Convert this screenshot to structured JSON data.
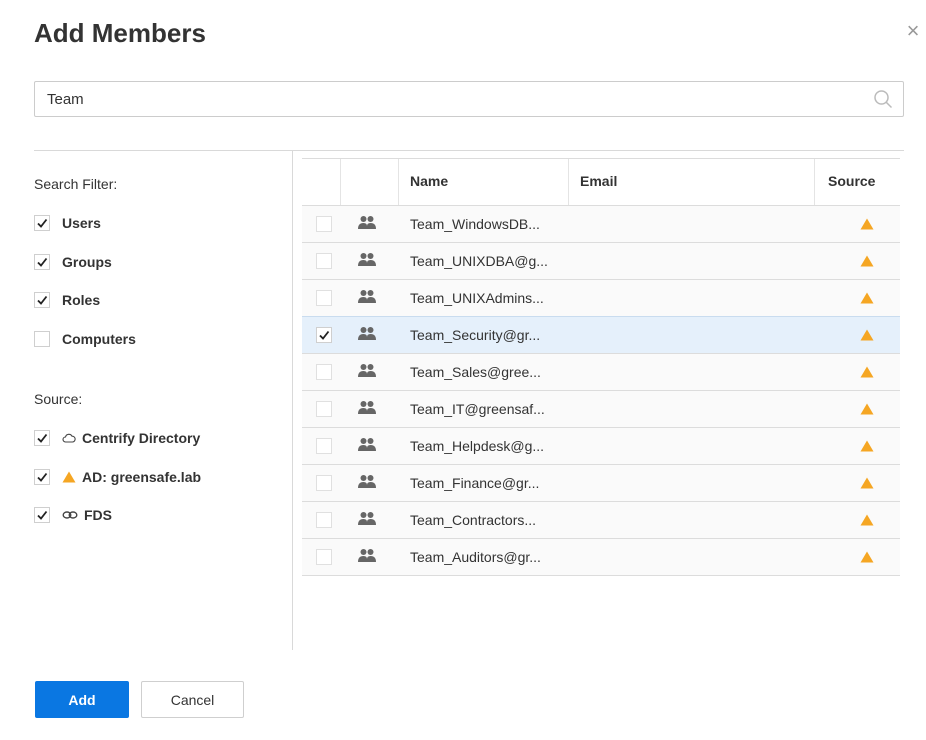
{
  "dialog": {
    "title": "Add Members",
    "close_glyph": "×"
  },
  "search": {
    "value": "Team",
    "placeholder": ""
  },
  "filters": {
    "search_filter_heading": "Search Filter:",
    "types": [
      {
        "label": "Users",
        "checked": true
      },
      {
        "label": "Groups",
        "checked": true
      },
      {
        "label": "Roles",
        "checked": true
      },
      {
        "label": "Computers",
        "checked": false
      }
    ],
    "source_heading": "Source:",
    "sources": [
      {
        "label": "Centrify Directory",
        "icon": "cloud-icon",
        "checked": true
      },
      {
        "label": "AD: greensafe.lab",
        "icon": "warning-triangle-icon",
        "checked": true
      },
      {
        "label": "FDS",
        "icon": "link-icon",
        "checked": true
      }
    ]
  },
  "grid": {
    "columns": [
      "Name",
      "Email",
      "Source"
    ],
    "rows": [
      {
        "name": "Team_WindowsDB...",
        "checked": false,
        "selected": false
      },
      {
        "name": "Team_UNIXDBA@g...",
        "checked": false,
        "selected": false
      },
      {
        "name": "Team_UNIXAdmins...",
        "checked": false,
        "selected": false
      },
      {
        "name": "Team_Security@gr...",
        "checked": true,
        "selected": true
      },
      {
        "name": "Team_Sales@gree...",
        "checked": false,
        "selected": false
      },
      {
        "name": "Team_IT@greensaf...",
        "checked": false,
        "selected": false
      },
      {
        "name": "Team_Helpdesk@g...",
        "checked": false,
        "selected": false
      },
      {
        "name": "Team_Finance@gr...",
        "checked": false,
        "selected": false
      },
      {
        "name": "Team_Contractors...",
        "checked": false,
        "selected": false
      },
      {
        "name": "Team_Auditors@gr...",
        "checked": false,
        "selected": false
      }
    ]
  },
  "buttons": {
    "add": "Add",
    "cancel": "Cancel"
  },
  "colors": {
    "accent": "#0a77e2",
    "ad_source": "#f5a623",
    "selected_row": "#e5f0fb",
    "group_icon": "#666666"
  }
}
